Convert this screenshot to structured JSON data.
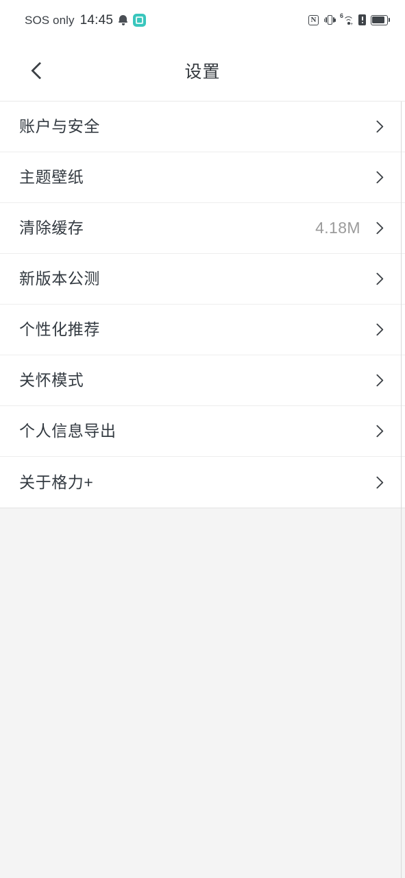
{
  "status_bar": {
    "carrier": "SOS only",
    "time": "14:45",
    "left_icons": [
      {
        "name": "notification-bell-icon"
      },
      {
        "name": "app-badge-icon",
        "color": "#39c6bd"
      }
    ],
    "right_icons": [
      {
        "name": "nfc-icon",
        "label": "N"
      },
      {
        "name": "vibrate-mode-icon"
      },
      {
        "name": "wifi-6-icon",
        "label": "6",
        "plus": "+"
      },
      {
        "name": "sim-alert-icon"
      },
      {
        "name": "battery-icon",
        "level": 80
      }
    ]
  },
  "header": {
    "back_label": "返回",
    "title": "设置"
  },
  "settings": {
    "rows": [
      {
        "label": "账户与安全",
        "value": ""
      },
      {
        "label": "主题壁纸",
        "value": ""
      },
      {
        "label": "清除缓存",
        "value": "4.18M"
      },
      {
        "label": "新版本公测",
        "value": ""
      },
      {
        "label": "个性化推荐",
        "value": ""
      },
      {
        "label": "关怀模式",
        "value": ""
      },
      {
        "label": "个人信息导出",
        "value": ""
      },
      {
        "label": "关于格力+",
        "value": ""
      }
    ]
  },
  "theme": {
    "page_background": "#f4f4f4",
    "surface": "#ffffff",
    "text_primary": "#333a41",
    "text_secondary": "#9b9b9b",
    "divider": "#ededed",
    "accent": "#39c6bd"
  }
}
